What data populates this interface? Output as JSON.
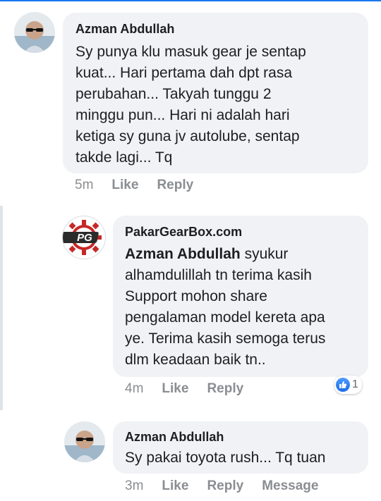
{
  "comments": [
    {
      "author": "Azman Abdullah",
      "lines": [
        "Sy punya klu masuk gear je sentap",
        "kuat... Hari pertama dah dpt rasa",
        "perubahan... Takyah tunggu 2",
        "minggu pun... Hari ni adalah hari",
        "ketiga sy guna jv autolube, sentap",
        "takde lagi... Tq"
      ],
      "time": "5m",
      "like_label": "Like",
      "reply_label": "Reply"
    },
    {
      "author": "PakarGearBox.com",
      "mention": "Azman Abdullah",
      "first_line_rest": " syukur",
      "lines": [
        "alhamdulillah tn terima kasih",
        "Support mohon share",
        "pengalaman model kereta apa",
        "ye. Terima kasih semoga terus",
        "dlm keadaan baik tn.."
      ],
      "time": "4m",
      "like_label": "Like",
      "reply_label": "Reply",
      "reaction_count": "1",
      "logo_text": "PG"
    },
    {
      "author": "Azman Abdullah",
      "lines": [
        "Sy pakai toyota rush... Tq tuan"
      ],
      "time": "3m",
      "like_label": "Like",
      "reply_label": "Reply",
      "message_label": "Message"
    }
  ],
  "colors": {
    "accent": "#1877f2",
    "bubble": "#f0f2f5",
    "meta": "#8a8d91"
  }
}
